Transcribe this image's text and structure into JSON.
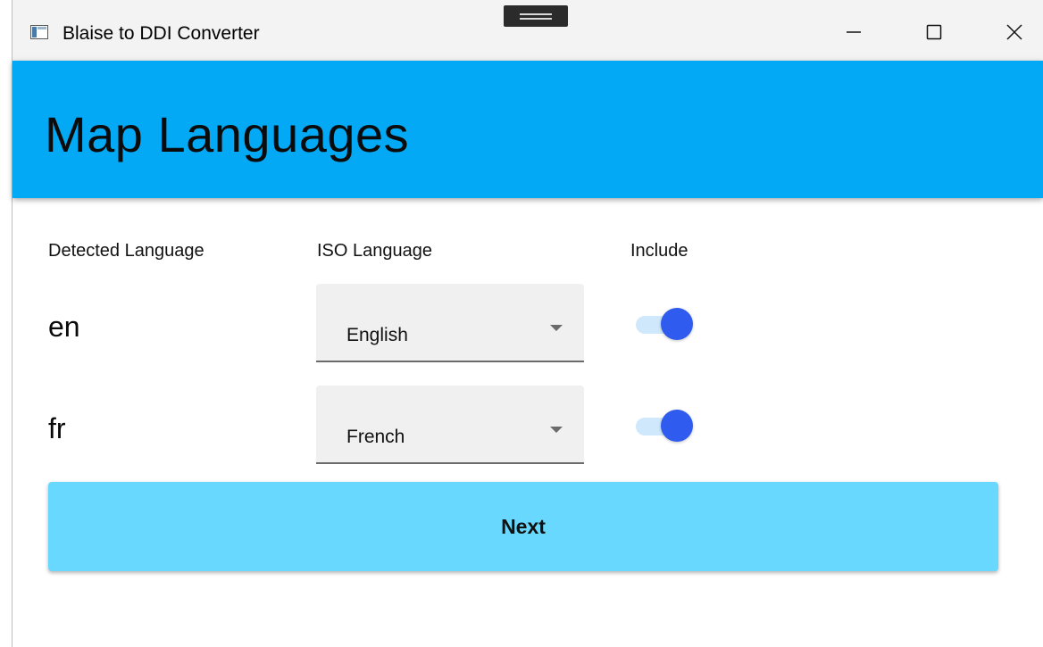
{
  "window": {
    "title": "Blaise to DDI Converter",
    "icons": {
      "app": "app-window-icon",
      "minimize": "minimize-icon",
      "maximize": "maximize-icon",
      "close": "close-icon"
    }
  },
  "header": {
    "title": "Map Languages",
    "background": "#03a9f4"
  },
  "columns": {
    "detected": "Detected Language",
    "iso": "ISO Language",
    "include": "Include"
  },
  "rows": [
    {
      "code": "en",
      "iso_value": "English",
      "include": true
    },
    {
      "code": "fr",
      "iso_value": "French",
      "include": true
    }
  ],
  "next_button": {
    "label": "Next",
    "background": "#68d8fe"
  },
  "colors": {
    "toggle_thumb": "#2f5bef",
    "toggle_track": "#cfe8fb"
  }
}
